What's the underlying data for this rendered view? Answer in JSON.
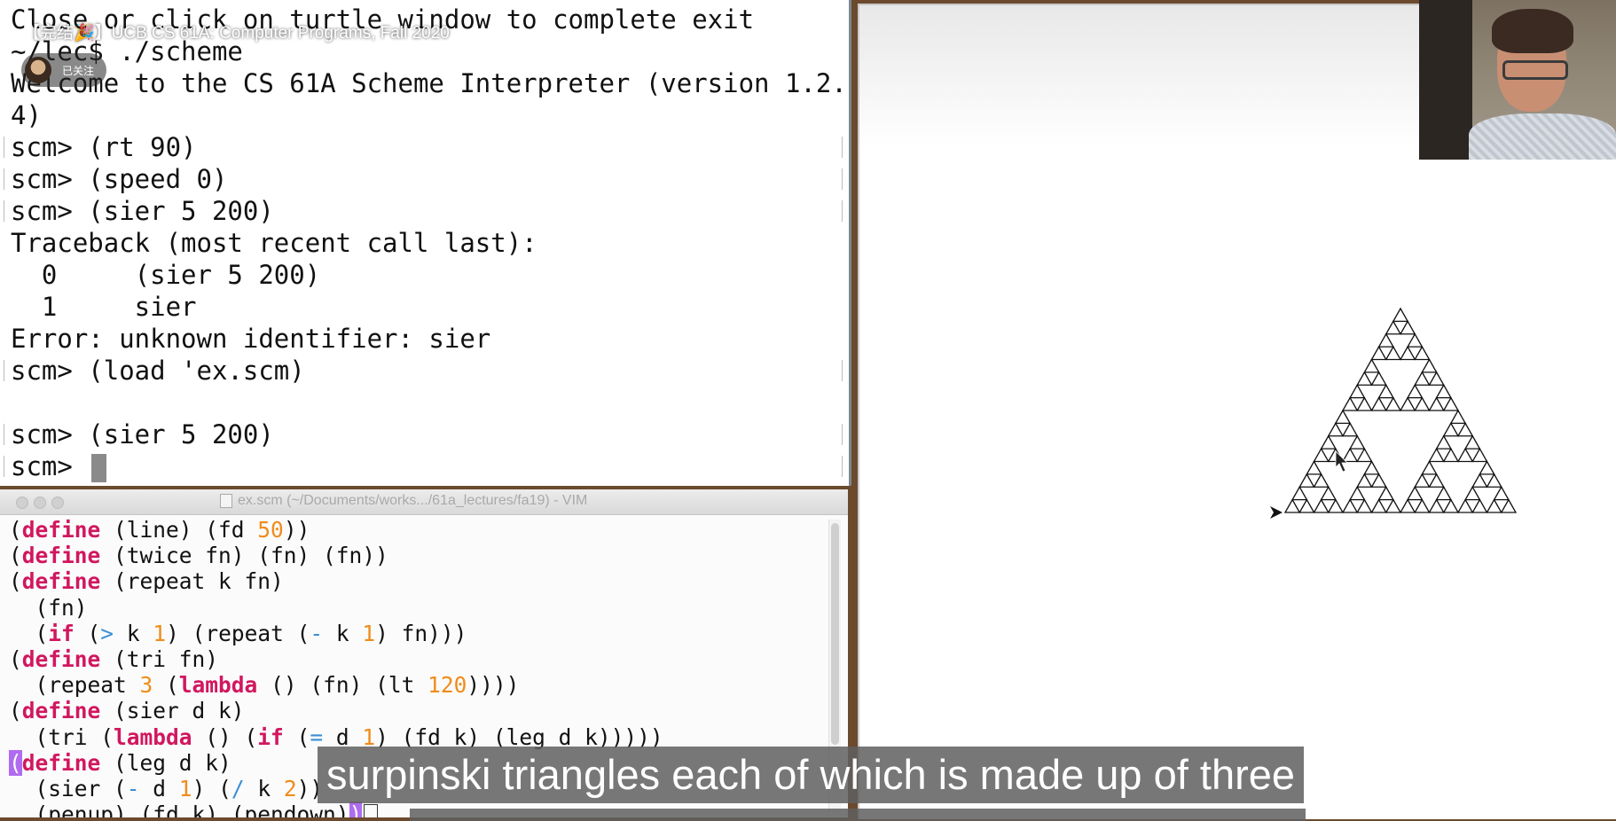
{
  "video": {
    "title": "【完结🎉】UCB CS 61A: Computer Programs, Fall 2020",
    "follow_label": "已关注"
  },
  "terminal": {
    "lines": [
      "Close or click on turtle window to complete exit",
      "~/lec$ ./scheme",
      "Welcome to the CS 61A Scheme Interpreter (version 1.2.",
      "4)",
      "scm> (rt 90)",
      "scm> (speed 0)",
      "scm> (sier 5 200)",
      "Traceback (most recent call last):",
      "  0     (sier 5 200)",
      "  1     sier",
      "Error: unknown identifier: sier",
      "scm> (load 'ex.scm)",
      "",
      "scm> (sier 5 200)",
      "scm> "
    ]
  },
  "vim": {
    "title": "ex.scm (~/Documents/works.../61a_lectures/fa19) - VIM",
    "code": [
      [
        [
          "(",
          ""
        ],
        [
          "define",
          "kw"
        ],
        [
          " (line) (fd ",
          ""
        ],
        [
          "50",
          "num"
        ],
        [
          "))",
          ""
        ]
      ],
      [
        [
          "(",
          ""
        ],
        [
          "define",
          "kw"
        ],
        [
          " (twice fn) (fn) (fn))",
          ""
        ]
      ],
      [
        [
          "(",
          ""
        ],
        [
          "define",
          "kw"
        ],
        [
          " (repeat k fn)",
          ""
        ]
      ],
      [
        [
          "  (fn)",
          ""
        ]
      ],
      [
        [
          "  (",
          ""
        ],
        [
          "if",
          "kw"
        ],
        [
          " (",
          ""
        ],
        [
          ">",
          "op"
        ],
        [
          " k ",
          ""
        ],
        [
          "1",
          "num"
        ],
        [
          ") (repeat (",
          ""
        ],
        [
          "-",
          "op"
        ],
        [
          " k ",
          ""
        ],
        [
          "1",
          "num"
        ],
        [
          ") fn)))",
          ""
        ]
      ],
      [
        [
          "(",
          ""
        ],
        [
          "define",
          "kw"
        ],
        [
          " (tri fn)",
          ""
        ]
      ],
      [
        [
          "  (repeat ",
          ""
        ],
        [
          "3",
          "num"
        ],
        [
          " (",
          ""
        ],
        [
          "lambda",
          "kw"
        ],
        [
          " () (fn) (lt ",
          ""
        ],
        [
          "120",
          "num"
        ],
        [
          "))))",
          ""
        ]
      ],
      [
        [
          "(",
          ""
        ],
        [
          "define",
          "kw"
        ],
        [
          " (sier d k)",
          ""
        ]
      ],
      [
        [
          "  (tri (",
          ""
        ],
        [
          "lambda",
          "kw"
        ],
        [
          " () (",
          ""
        ],
        [
          "if",
          "kw"
        ],
        [
          " (",
          ""
        ],
        [
          "=",
          "op"
        ],
        [
          " d ",
          ""
        ],
        [
          "1",
          "num"
        ],
        [
          ") (fd k) (leg d k)))))",
          ""
        ]
      ],
      [
        [
          "(",
          "bracket-hl"
        ],
        [
          "define",
          "kw"
        ],
        [
          " (leg d k)",
          ""
        ]
      ],
      [
        [
          "  (sier (",
          ""
        ],
        [
          "-",
          "op"
        ],
        [
          " d ",
          ""
        ],
        [
          "1",
          "num"
        ],
        [
          ") (",
          ""
        ],
        [
          "/",
          "op"
        ],
        [
          " k ",
          ""
        ],
        [
          "2",
          "num"
        ],
        [
          "))",
          ""
        ]
      ],
      [
        [
          "  (penup) (fd k) (pendown)",
          ""
        ],
        [
          ")",
          "bracket-hl"
        ]
      ]
    ]
  },
  "turtle": {
    "depth": 5,
    "size": 200
  },
  "subtitle": {
    "text": "surpinski triangles each of which is made up of three"
  },
  "colors": {
    "keyword": "#d1175f",
    "number": "#f08c1a",
    "operator": "#3a8fd6",
    "bracket_highlight": "#b06cf0"
  }
}
